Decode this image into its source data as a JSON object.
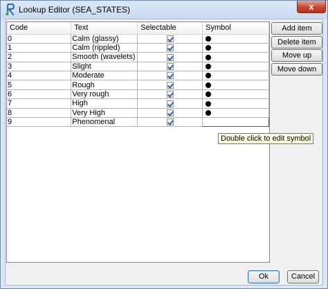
{
  "window": {
    "title": "Lookup Editor (SEA_STATES)",
    "close_label": "x"
  },
  "table": {
    "columns": [
      "Code",
      "Text",
      "Selectable",
      "Symbol"
    ],
    "rows": [
      {
        "code": "0",
        "text": "Calm (glassy)",
        "selectable": true,
        "symbol": "filled-circle"
      },
      {
        "code": "1",
        "text": "Calm (rippled)",
        "selectable": true,
        "symbol": "filled-circle"
      },
      {
        "code": "2",
        "text": "Smooth (wavelets)",
        "selectable": true,
        "symbol": "filled-circle"
      },
      {
        "code": "3",
        "text": "Slight",
        "selectable": true,
        "symbol": "filled-circle"
      },
      {
        "code": "4",
        "text": "Moderate",
        "selectable": true,
        "symbol": "filled-circle"
      },
      {
        "code": "5",
        "text": "Rough",
        "selectable": true,
        "symbol": "filled-circle"
      },
      {
        "code": "6",
        "text": "Very rough",
        "selectable": true,
        "symbol": "filled-circle"
      },
      {
        "code": "7",
        "text": "High",
        "selectable": true,
        "symbol": "filled-circle"
      },
      {
        "code": "8",
        "text": "Very High",
        "selectable": true,
        "symbol": "filled-circle"
      },
      {
        "code": "9",
        "text": "Phenomenal",
        "selectable": true,
        "symbol": ""
      }
    ]
  },
  "tooltip": "Double click to edit symbol",
  "side_buttons": {
    "add": "Add item",
    "delete": "Delete item",
    "up": "Move up",
    "down": "Move down"
  },
  "footer": {
    "ok": "Ok",
    "cancel": "Cancel"
  },
  "colors": {
    "check": "#3a5dae",
    "tooltip_bg": "#ffffe1"
  }
}
